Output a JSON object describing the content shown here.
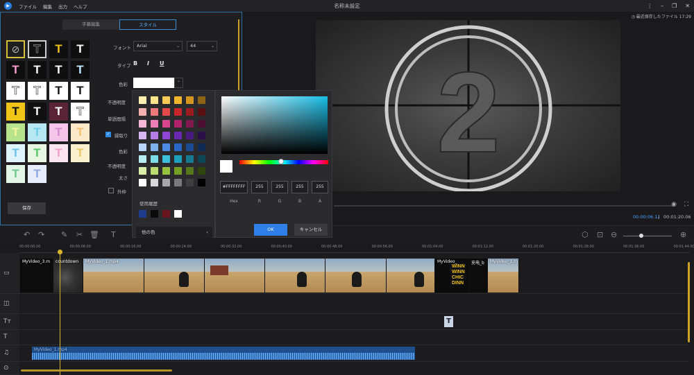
{
  "menu": [
    "ファイル",
    "編集",
    "出力",
    "ヘルプ"
  ],
  "window_title": "名称未設定",
  "recent_file": "最近保存したファイル 17:29",
  "editor": {
    "tabs": [
      "字幕編集",
      "スタイル"
    ],
    "font_label": "フォント",
    "font_value": "Arial",
    "size_value": "44",
    "type_label": "タイプ",
    "bold": "B",
    "italic": "I",
    "underline": "U",
    "color_label": "色彩",
    "opacity_label": "不透明度",
    "spacing_label": "単語間隔",
    "outline_label": "縁取り",
    "outline_color_label": "色彩",
    "outline_opacity_label": "不透明度",
    "thickness_label": "太さ",
    "outer_label": "外枠",
    "save": "保存"
  },
  "style_presets": [
    {
      "glyph": "⊘",
      "bg": "#1e1e1e",
      "fg": "#bbbbbb",
      "border": "#d4c13a"
    },
    {
      "glyph": "T",
      "bg": "#111111",
      "fg": "#111111",
      "border": "#cfcfcf",
      "outline": true
    },
    {
      "glyph": "T",
      "bg": "#0f0f0f",
      "fg": "#f1c418"
    },
    {
      "glyph": "T",
      "bg": "#0f0f0f",
      "fg": "#ffffff"
    },
    {
      "glyph": "T",
      "bg": "#0f0f0f",
      "fg": "#ff9fcf"
    },
    {
      "glyph": "T",
      "bg": "#0f0f0f",
      "fg": "#ffffff"
    },
    {
      "glyph": "T",
      "bg": "#0f0f0f",
      "fg": "#ffffff"
    },
    {
      "glyph": "T",
      "bg": "#0f0f0f",
      "fg": "#bfe6ff"
    },
    {
      "glyph": "T",
      "bg": "#ffffff",
      "fg": "#ffffff",
      "outline": true
    },
    {
      "glyph": "T",
      "bg": "#ffffff",
      "fg": "#ffffff",
      "outline": true
    },
    {
      "glyph": "T",
      "bg": "#ffffff",
      "fg": "#111111"
    },
    {
      "glyph": "T",
      "bg": "#ffffff",
      "fg": "#111111"
    },
    {
      "glyph": "T",
      "bg": "#f1c418",
      "fg": "#111111"
    },
    {
      "glyph": "T",
      "bg": "#111111",
      "fg": "#ffffff"
    },
    {
      "glyph": "T",
      "bg": "#5a2436",
      "fg": "#ffffff"
    },
    {
      "glyph": "T",
      "bg": "#ffffff",
      "fg": "#ffffff",
      "outline": true
    },
    {
      "glyph": "T",
      "bg": "#b6e38c",
      "fg": "#f4f59b"
    },
    {
      "glyph": "T",
      "bg": "#b6e8f4",
      "fg": "#6fcce9"
    },
    {
      "glyph": "T",
      "bg": "#f5c6e9",
      "fg": "#d48cd0"
    },
    {
      "glyph": "T",
      "bg": "#fbe9c9",
      "fg": "#f5c071"
    },
    {
      "glyph": "T",
      "bg": "#dff3fa",
      "fg": "#6cc4ea"
    },
    {
      "glyph": "T",
      "bg": "#e6f6e1",
      "fg": "#59c76a"
    },
    {
      "glyph": "T",
      "bg": "#fbe6ef",
      "fg": "#f0a1c7"
    },
    {
      "glyph": "T",
      "bg": "#fbf1cf",
      "fg": "#e9c96a"
    },
    {
      "glyph": "T",
      "bg": "#e3f5e6",
      "fg": "#6fc88e"
    },
    {
      "glyph": "T",
      "bg": "#e7edfa",
      "fg": "#8fa8e3"
    }
  ],
  "palette": {
    "colors": [
      "#fdf0b2",
      "#fde38b",
      "#f8cb56",
      "#f2b42a",
      "#d5961f",
      "#8c6414",
      "#f7b0b0",
      "#ef7878",
      "#e44a4a",
      "#c8242b",
      "#9c1b21",
      "#5a0f12",
      "#f5b7d6",
      "#ec7fb5",
      "#d9468d",
      "#b0236b",
      "#81194f",
      "#4d0f31",
      "#d8b6f2",
      "#b57ce6",
      "#8f46d5",
      "#6a27b0",
      "#4a1b80",
      "#2a0f4a",
      "#b9d4f6",
      "#7fb0ec",
      "#4d8ce2",
      "#2a66c6",
      "#1c4a92",
      "#0f2a56",
      "#b6ecf2",
      "#7ddbe8",
      "#3ec0d8",
      "#1ea0bc",
      "#177a90",
      "#0c4654",
      "#d9eea9",
      "#bcdc72",
      "#96c240",
      "#75a024",
      "#56781b",
      "#30440f",
      "#ffffff",
      "#d9d9d9",
      "#a8a8a8",
      "#7a7a7a",
      "#3f3f3f",
      "#000000"
    ],
    "history_label": "使用履歴",
    "history": [
      "#1f3c8c",
      "#0b0b0b",
      "#6a1420",
      "#ffffff"
    ],
    "other_colors": "他の色"
  },
  "picker": {
    "hex": "#FFFFFFFF",
    "r": "255",
    "g": "255",
    "b": "255",
    "a": "255",
    "hex_label": "Hex",
    "r_label": "R",
    "g_label": "G",
    "b_label": "B",
    "a_label": "A",
    "ok": "OK",
    "cancel": "キャンセル"
  },
  "preview": {
    "countdown_number": "2",
    "time_current": "00:00:06.11",
    "time_sep": "/",
    "time_total": "00:01:20.06"
  },
  "ruler_ticks": [
    "00:00:00.00",
    "00:00:08.00",
    "00:00:16.00",
    "00:00:24.00",
    "00:00:32.00",
    "00:00:40.00",
    "00:00:48.00",
    "00:00:56.00",
    "00:01:04.00",
    "00:01:12.00",
    "00:01:20.00",
    "00:01:28.00",
    "00:01:36.00",
    "00:01:44.00"
  ],
  "clips": {
    "c1": "MyVideo_3.m",
    "c2": "countdown",
    "c3": "MyVideo_1.mp4",
    "c4": "MyVideo_",
    "c5": "充电_b",
    "c6": "MyVideo_1.m",
    "text_clip": "T",
    "audio": "MyVideo_1.mp4",
    "winner_text": "WINN WINN CHIC DINN"
  },
  "colors": {
    "accent": "#2f7fe6",
    "playhead": "#d8b52a",
    "panel_border": "#2c6fa3"
  }
}
